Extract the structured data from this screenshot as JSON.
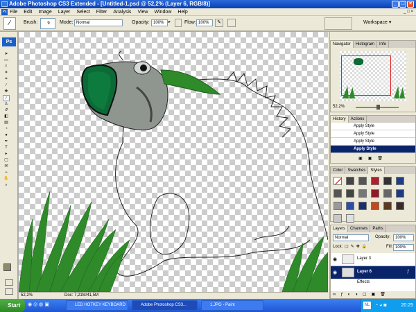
{
  "title_bar": {
    "title": "Adobe Photoshop CS3 Extended - [Untitled-1.psd @ 52,2% (Layer 6, RGB/8)]",
    "doc_controls": [
      "_",
      "□",
      "×"
    ]
  },
  "menu": {
    "items": [
      "File",
      "Edit",
      "Image",
      "Layer",
      "Select",
      "Filter",
      "Analysis",
      "View",
      "Window",
      "Help"
    ]
  },
  "options_bar": {
    "brush_label": "Brush:",
    "brush_size": "9",
    "mode_label": "Mode:",
    "mode_value": "Normal",
    "opacity_label": "Opacity:",
    "opacity_value": "100%",
    "flow_label": "Flow:",
    "flow_value": "100%",
    "workspace_label": "Workspace"
  },
  "toolbox": {
    "logo": "Ps"
  },
  "status_bar": {
    "zoom": "52,2%",
    "doc_info": "Doc: 7,21M/41,5M"
  },
  "navigator": {
    "tabs": [
      "Navigator",
      "Histogram",
      "Info"
    ],
    "zoom": "52,2%"
  },
  "history": {
    "tabs": [
      "History",
      "Actions"
    ],
    "rows": [
      "Apply Style",
      "Apply Style",
      "Apply Style",
      "Apply Style"
    ]
  },
  "styles": {
    "tabs": [
      "Color",
      "Swatches",
      "Styles"
    ]
  },
  "layers": {
    "tabs": [
      "Layers",
      "Channels",
      "Paths"
    ],
    "blend_mode": "Normal",
    "opacity_label": "Opacity:",
    "opacity_value": "100%",
    "lock_label": "Lock:",
    "fill_label": "Fill:",
    "fill_value": "100%",
    "rows": [
      "Layer 3",
      "Layer 6",
      "Effects"
    ]
  },
  "taskbar": {
    "start": "Start",
    "tasks": [
      "LED HOTKEY KEYBOARD",
      "Adobe Photoshop CS3...",
      "1.JPG - Paint"
    ],
    "lang": "NL",
    "clock": "20:25"
  },
  "colors": {
    "titlebar": "#0a3fb3",
    "selection": "#0a246a",
    "grass": "#2f8a2a",
    "fish_mouth": "#0b6a36"
  }
}
